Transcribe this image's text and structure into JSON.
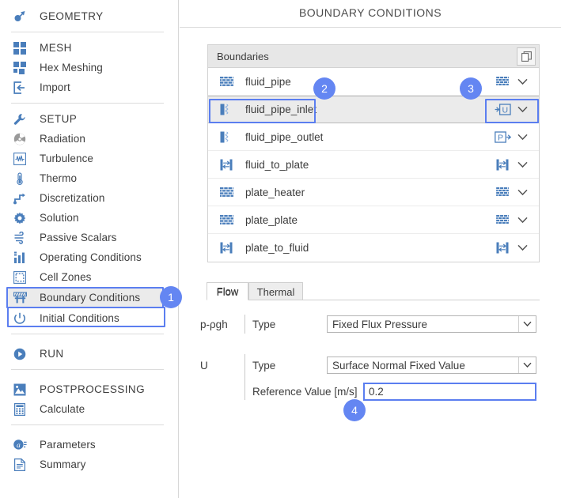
{
  "header": {
    "title": "BOUNDARY CONDITIONS"
  },
  "sidebar": {
    "groups": [
      {
        "items": [
          {
            "label": "GEOMETRY",
            "icon": "geometry-icon",
            "header": true
          }
        ]
      },
      {
        "items": [
          {
            "label": "MESH",
            "icon": "mesh-icon",
            "header": true
          },
          {
            "label": "Hex Meshing",
            "icon": "hex-meshing-icon"
          },
          {
            "label": "Import",
            "icon": "import-icon"
          }
        ]
      },
      {
        "items": [
          {
            "label": "SETUP",
            "icon": "wrench-icon",
            "header": true
          },
          {
            "label": "Radiation",
            "icon": "radiation-icon"
          },
          {
            "label": "Turbulence",
            "icon": "turbulence-icon"
          },
          {
            "label": "Thermo",
            "icon": "thermometer-icon"
          },
          {
            "label": "Discretization",
            "icon": "discretization-icon"
          },
          {
            "label": "Solution",
            "icon": "gear-icon"
          },
          {
            "label": "Passive Scalars",
            "icon": "wind-icon"
          },
          {
            "label": "Operating Conditions",
            "icon": "bar-chart-icon"
          },
          {
            "label": "Cell Zones",
            "icon": "dashed-square-icon"
          },
          {
            "label": "Boundary Conditions",
            "icon": "barrier-icon",
            "selected": true
          },
          {
            "label": "Initial Conditions",
            "icon": "power-icon"
          }
        ]
      },
      {
        "items": [
          {
            "label": "RUN",
            "icon": "play-icon",
            "header": true
          }
        ]
      },
      {
        "items": [
          {
            "label": "POSTPROCESSING",
            "icon": "image-icon",
            "header": true
          },
          {
            "label": "Calculate",
            "icon": "calculator-icon"
          }
        ]
      },
      {
        "items": [
          {
            "label": "Parameters",
            "icon": "at-parameters-icon"
          },
          {
            "label": "Summary",
            "icon": "document-icon"
          }
        ]
      }
    ]
  },
  "boundaries": {
    "panel_title": "Boundaries",
    "copy_button_icon": "copy-icon",
    "rows": [
      {
        "name": "fluid_pipe",
        "left_icon": "wall-brick-icon",
        "right_icon": "wall-brick-icon",
        "chevron": "chevron-down-icon"
      },
      {
        "name": "fluid_pipe_inlet",
        "left_icon": "patch-inlet-icon",
        "right_icon": "velocity-inlet-icon",
        "chevron": "chevron-down-icon",
        "selected": true
      },
      {
        "name": "fluid_pipe_outlet",
        "left_icon": "patch-inlet-icon",
        "right_icon": "pressure-outlet-icon",
        "chevron": "chevron-down-icon"
      },
      {
        "name": "fluid_to_plate",
        "left_icon": "interface-icon",
        "right_icon": "interface-icon",
        "chevron": "chevron-down-icon"
      },
      {
        "name": "plate_heater",
        "left_icon": "wall-brick-icon",
        "right_icon": "wall-brick-icon",
        "chevron": "chevron-down-icon"
      },
      {
        "name": "plate_plate",
        "left_icon": "wall-brick-icon",
        "right_icon": "wall-brick-icon",
        "chevron": "chevron-down-icon"
      },
      {
        "name": "plate_to_fluid",
        "left_icon": "interface-icon",
        "right_icon": "interface-icon",
        "chevron": "chevron-down-icon"
      }
    ]
  },
  "tabs": [
    {
      "label": "Flow",
      "active": true
    },
    {
      "label": "Thermal",
      "active": false
    }
  ],
  "form": {
    "pressure": {
      "variable": "p-ρgh",
      "type_label": "Type",
      "type_value": "Fixed Flux Pressure"
    },
    "velocity": {
      "variable": "U",
      "type_label": "Type",
      "type_value": "Surface Normal Fixed Value",
      "reference_label": "Reference Value [m/s]",
      "reference_value": "0.2"
    }
  },
  "callouts": [
    {
      "number": "1"
    },
    {
      "number": "2"
    },
    {
      "number": "3"
    },
    {
      "number": "4"
    }
  ],
  "colors": {
    "accent_blue": "#4a7ebb",
    "callout_blue": "#6486f2",
    "highlight_border": "#5b7ef0",
    "panel_header_bg": "#e7e7e7",
    "selected_row_bg": "#ebebeb"
  }
}
